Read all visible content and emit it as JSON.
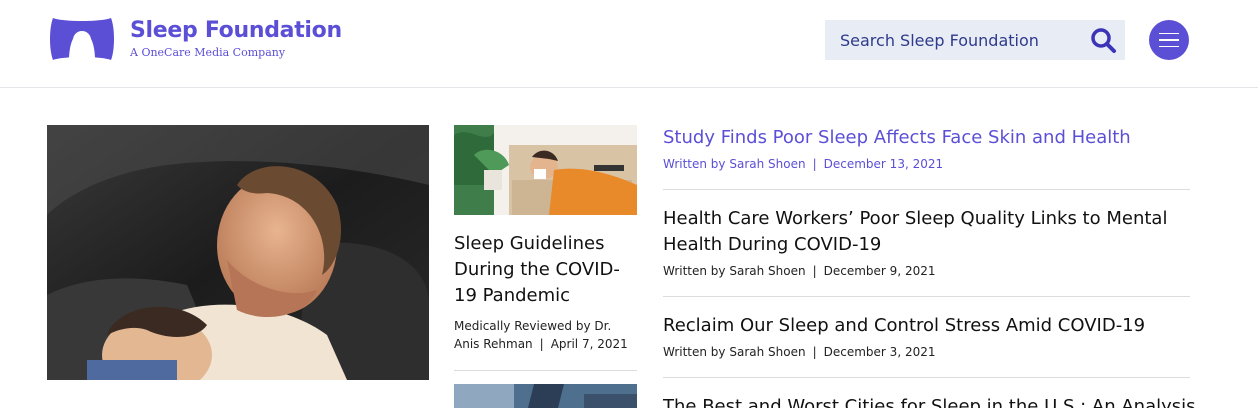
{
  "header": {
    "brand_title": "Sleep Foundation",
    "brand_subtitle": "A OneCare Media Company",
    "search_placeholder": "Search Sleep Foundation",
    "accent_color": "#5b4fd6"
  },
  "featured_middle": {
    "title": "Sleep Guidelines During the COVID-19 Pandemic",
    "byline_prefix": "Medically Reviewed by",
    "author": "Dr. Anis Rehman",
    "date": "April 7, 2021"
  },
  "articles": [
    {
      "title": "Study Finds Poor Sleep Affects Face Skin and Health",
      "byline_prefix": "Written by",
      "author": "Sarah Shoen",
      "date": "December 13, 2021",
      "active": true
    },
    {
      "title": "Health Care Workers’ Poor Sleep Quality Links to Mental Health During COVID-19",
      "byline_prefix": "Written by",
      "author": "Sarah Shoen",
      "date": "December 9, 2021",
      "active": false
    },
    {
      "title": "Reclaim Our Sleep and Control Stress Amid COVID-19",
      "byline_prefix": "Written by",
      "author": "Sarah Shoen",
      "date": "December 3, 2021",
      "active": false
    },
    {
      "title": "The Best and Worst Cities for Sleep in the U.S.: An Analysis",
      "byline_prefix": "",
      "author": "",
      "date": "",
      "active": false
    }
  ],
  "icons": {
    "logo": "pillow-logo-icon",
    "search": "search-icon",
    "menu": "hamburger-menu-icon"
  }
}
